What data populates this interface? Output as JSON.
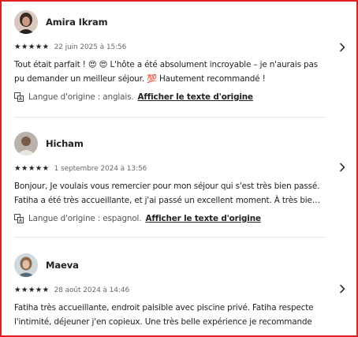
{
  "reviews": [
    {
      "name": "Amira Ikram",
      "stars": "★★★★★",
      "date": "22 juin 2025 à 15:56",
      "text": "Tout était parfait ! 😍 😍 L'hôte a été absolument incroyable – je n'aurais pas pu demander un meilleur séjour. 💯 Hautement recommandé !",
      "lang_label": "Langue d'origine : anglais.",
      "show_original": "Afficher le texte d'origine"
    },
    {
      "name": "Hicham",
      "stars": "★★★★★",
      "date": "1 septembre 2024 à 13:56",
      "text_line1": "Bonjour, Je voulais vous remercier pour mon séjour qui s'est très bien passé.",
      "text_line2": "Fatiha a été très accueillante, et j'ai passé un excellent moment. À très bientô...",
      "lang_label": "Langue d'origine : espagnol.",
      "show_original": "Afficher le texte d'origine"
    },
    {
      "name": "Maeva",
      "stars": "★★★★★",
      "date": "28 août 2024 à 14:46",
      "text": "Fatiha très accueillante, endroit paisible avec piscine privé. Fatiha respecte l'intimité, déjeuner j'en copieux. Une très belle expérience je recommande"
    }
  ],
  "icons": {
    "chevron": "chevron-right-icon",
    "translate": "translate-icon"
  },
  "colors": {
    "frame": "#e02020",
    "text": "#222222",
    "muted": "#6a6a6a",
    "divider": "#e6e6e6"
  }
}
